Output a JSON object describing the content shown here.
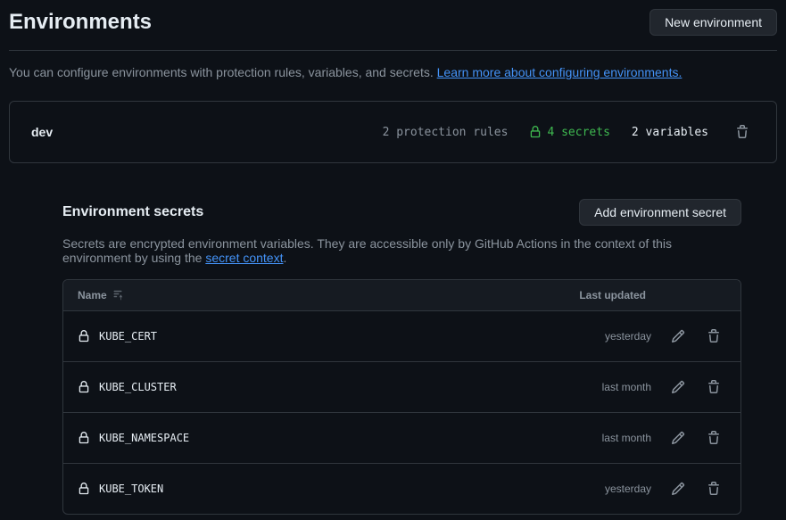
{
  "header": {
    "title": "Environments",
    "new_btn": "New environment"
  },
  "description": {
    "text": "You can configure environments with protection rules, variables, and secrets. ",
    "link": "Learn more about configuring environments."
  },
  "env": {
    "name": "dev",
    "protection": "2 protection rules",
    "secrets": "4 secrets",
    "variables": "2 variables"
  },
  "secrets_section": {
    "title": "Environment secrets",
    "add_btn": "Add environment secret",
    "desc_text": "Secrets are encrypted environment variables. They are accessible only by GitHub Actions in the context of this environment by using the ",
    "desc_link": "secret context",
    "desc_suffix": ".",
    "col_name": "Name",
    "col_updated": "Last updated"
  },
  "secrets": [
    {
      "name": "KUBE_CERT",
      "updated": "yesterday"
    },
    {
      "name": "KUBE_CLUSTER",
      "updated": "last month"
    },
    {
      "name": "KUBE_NAMESPACE",
      "updated": "last month"
    },
    {
      "name": "KUBE_TOKEN",
      "updated": "yesterday"
    }
  ]
}
